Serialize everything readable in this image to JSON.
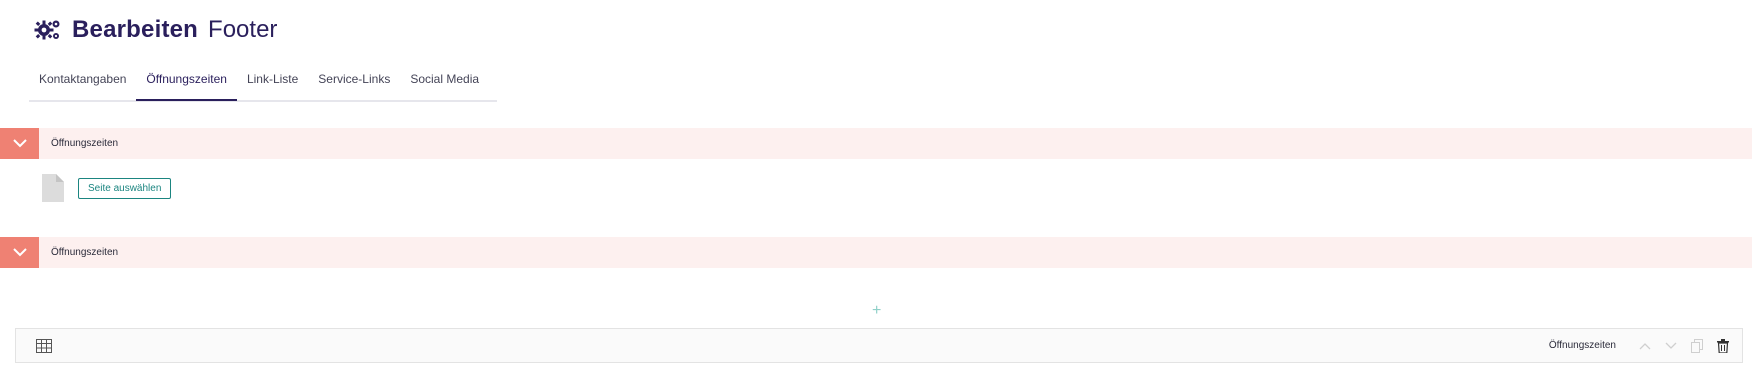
{
  "header": {
    "title_strong": "Bearbeiten",
    "title_light": "Footer",
    "icon": "gears-icon"
  },
  "tabs": [
    {
      "label": "Kontaktangaben"
    },
    {
      "label": "Öffnungszeiten",
      "active": true
    },
    {
      "label": "Link-Liste"
    },
    {
      "label": "Service-Links"
    },
    {
      "label": "Social Media"
    }
  ],
  "sections": [
    {
      "label": "Öffnungszeiten"
    },
    {
      "label": "Öffnungszeiten"
    }
  ],
  "page_select": {
    "button_label": "Seite auswählen",
    "icon": "file-icon"
  },
  "add": {
    "label": "+"
  },
  "footer_bar": {
    "label": "Öffnungszeiten",
    "icons": [
      "table-icon",
      "arrow-up-icon",
      "arrow-down-icon",
      "copy-icon",
      "trash-icon"
    ]
  },
  "colors": {
    "brand": "#2a1f5c",
    "accent": "#ef8173",
    "section_bg": "#fdf0ef",
    "teal": "#1b8580"
  }
}
